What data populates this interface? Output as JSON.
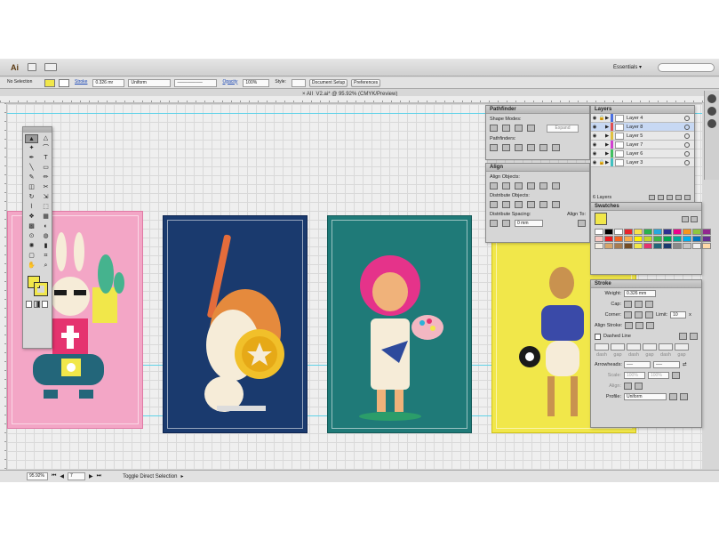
{
  "app": {
    "logo": "Ai",
    "workspace": "Essentials",
    "workspace_arrow": "▾"
  },
  "control": {
    "selection": "No Selection",
    "stroke_link": "Stroke",
    "stroke_weight": "0.326 mr",
    "profile": "Uniform",
    "opacity_link": "Opacity",
    "opacity_value": "100%",
    "style_label": "Style:",
    "document_setup": "Document Setup",
    "preferences": "Preferences"
  },
  "document": {
    "tab_title": "AII_V2.ai* @ 95.92% (CMYK/Preview)",
    "close_icon": "×"
  },
  "status": {
    "zoom": "95.92%",
    "page": "7",
    "tool_text": "Toggle Direct Selection"
  },
  "tools": [
    {
      "glyph": "▲",
      "name": "selection-tool"
    },
    {
      "glyph": "△",
      "name": "direct-selection-tool"
    },
    {
      "glyph": "✦",
      "name": "magic-wand-tool"
    },
    {
      "glyph": "⌒",
      "name": "lasso-tool"
    },
    {
      "glyph": "✒",
      "name": "pen-tool"
    },
    {
      "glyph": "T",
      "name": "type-tool"
    },
    {
      "glyph": "╲",
      "name": "line-tool"
    },
    {
      "glyph": "▭",
      "name": "rectangle-tool"
    },
    {
      "glyph": "✎",
      "name": "paintbrush-tool"
    },
    {
      "glyph": "✏",
      "name": "pencil-tool"
    },
    {
      "glyph": "◫",
      "name": "eraser-tool"
    },
    {
      "glyph": "✂",
      "name": "scissors-tool"
    },
    {
      "glyph": "↻",
      "name": "rotate-tool"
    },
    {
      "glyph": "⇲",
      "name": "scale-tool"
    },
    {
      "glyph": "⌇",
      "name": "width-tool"
    },
    {
      "glyph": "⬚",
      "name": "free-transform-tool"
    },
    {
      "glyph": "❖",
      "name": "shape-builder-tool"
    },
    {
      "glyph": "▦",
      "name": "perspective-tool"
    },
    {
      "glyph": "▩",
      "name": "mesh-tool"
    },
    {
      "glyph": "◐",
      "name": "gradient-tool"
    },
    {
      "glyph": "⊙",
      "name": "eyedropper-tool"
    },
    {
      "glyph": "◍",
      "name": "blend-tool"
    },
    {
      "glyph": "✺",
      "name": "symbol-sprayer-tool"
    },
    {
      "glyph": "▮",
      "name": "graph-tool"
    },
    {
      "glyph": "▢",
      "name": "artboard-tool"
    },
    {
      "glyph": "⌗",
      "name": "slice-tool"
    },
    {
      "glyph": "✋",
      "name": "hand-tool"
    },
    {
      "glyph": "⌕",
      "name": "zoom-tool"
    }
  ],
  "pathfinder": {
    "title": "Pathfinder",
    "shape_modes": "Shape Modes:",
    "expand": "Expand",
    "pathfinders": "Pathfinders:"
  },
  "align": {
    "title": "Align",
    "align_objects": "Align Objects:",
    "distribute_objects": "Distribute Objects:",
    "distribute_spacing": "Distribute Spacing:",
    "align_to": "Align To:"
  },
  "layers": {
    "title": "Layers",
    "count": "6 Layers",
    "items": [
      {
        "name": "Layer 4",
        "color": "#4b6fe0",
        "selected": false,
        "locked": true
      },
      {
        "name": "Layer 8",
        "color": "#e05050",
        "selected": true,
        "locked": false
      },
      {
        "name": "Layer 5",
        "color": "#e0c040",
        "selected": false,
        "locked": false
      },
      {
        "name": "Layer 7",
        "color": "#d040d0",
        "selected": false,
        "locked": false
      },
      {
        "name": "Layer 6",
        "color": "#40c060",
        "selected": false,
        "locked": false
      },
      {
        "name": "Layer 3",
        "color": "#40c0c0",
        "selected": false,
        "locked": true
      }
    ]
  },
  "swatches": {
    "title": "Swatches",
    "colors": [
      "#ffffff",
      "#000000",
      "#ffffff",
      "#e8242c",
      "#f7e04a",
      "#2bb24c",
      "#26a9e0",
      "#2e3192",
      "#ec008c",
      "#f7941d",
      "#8dc63f",
      "#92278f",
      "#f7c7c1",
      "#ed1c24",
      "#f26522",
      "#f7ac4d",
      "#fff200",
      "#c3d52a",
      "#39b54a",
      "#00a651",
      "#00a99d",
      "#00aeef",
      "#0072bc",
      "#662d91",
      "#f4ede2",
      "#d6a66b",
      "#a67c52",
      "#754c24",
      "#f1e74a",
      "#e5336f",
      "#23667a",
      "#1a3a6e",
      "#8a8a8a",
      "#c7c7c7",
      "#f0f0f0",
      "#ffd9a8"
    ]
  },
  "stroke_panel": {
    "title": "Stroke",
    "weight_label": "Weight:",
    "weight": "0.326 mm",
    "cap_label": "Cap:",
    "corner_label": "Corner:",
    "limit_label": "Limit:",
    "limit": "10",
    "limit_x": "x",
    "align_label": "Align Stroke:",
    "dashed": "Dashed Line",
    "dash_labels": [
      "dash",
      "gap",
      "dash",
      "gap",
      "dash",
      "gap"
    ],
    "arrowheads": "Arrowheads:",
    "scale_label": "Scale:",
    "scale1": "100%",
    "scale2": "100%",
    "align_arrow": "Align:",
    "profile_label": "Profile:",
    "profile": "Uniform"
  }
}
